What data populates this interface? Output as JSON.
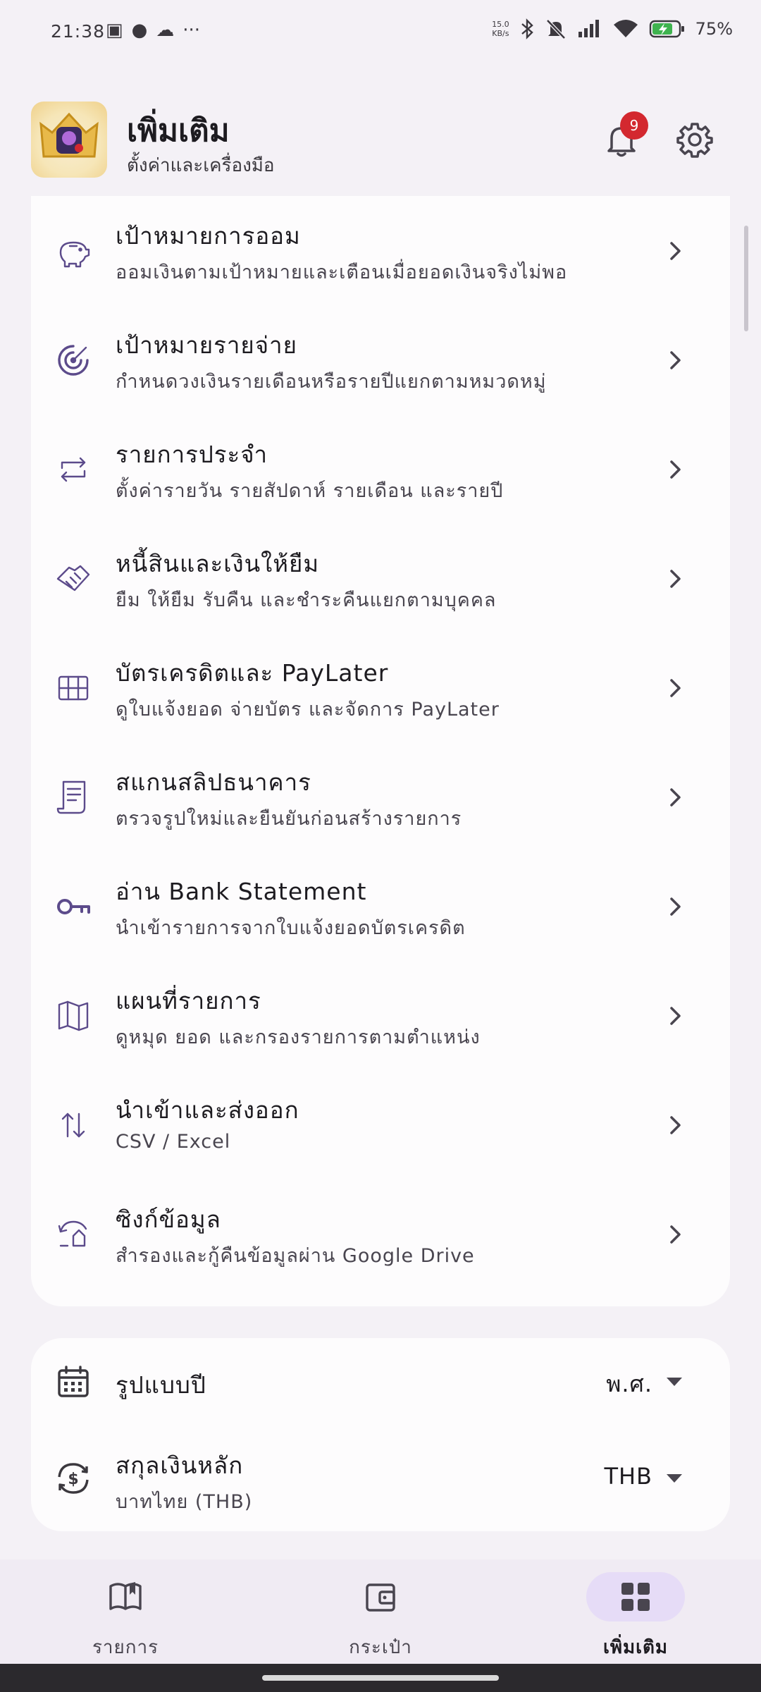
{
  "status_bar": {
    "time": "21:38",
    "speed_top": "15.0",
    "speed_bottom": "KB/s",
    "battery": "75%"
  },
  "header": {
    "title": "เพิ่มเติม",
    "subtitle": "ตั้งค่าและเครื่องมือ",
    "notification_count": "9"
  },
  "menu": {
    "items": [
      {
        "icon": "piggy-bank-icon",
        "title": "เป้าหมายการออม",
        "subtitle": "ออมเงินตามเป้าหมายและเตือนเมื่อยอดเงินจริงไม่พอ"
      },
      {
        "icon": "target-icon",
        "title": "เป้าหมายรายจ่าย",
        "subtitle": "กำหนดวงเงินรายเดือนหรือรายปีแยกตามหมวดหมู่"
      },
      {
        "icon": "repeat-icon",
        "title": "รายการประจำ",
        "subtitle": "ตั้งค่ารายวัน รายสัปดาห์ รายเดือน และรายปี"
      },
      {
        "icon": "handshake-icon",
        "title": "หนี้สินและเงินให้ยืม",
        "subtitle": "ยืม ให้ยืม รับคืน และชำระคืนแยกตามบุคคล"
      },
      {
        "icon": "grid-card-icon",
        "title": "บัตรเครดิตและ PayLater",
        "subtitle": "ดูใบแจ้งยอด จ่ายบัตร และจัดการ PayLater"
      },
      {
        "icon": "receipt-icon",
        "title": "สแกนสลิปธนาคาร",
        "subtitle": "ตรวจรูปใหม่และยืนยันก่อนสร้างรายการ"
      },
      {
        "icon": "key-icon",
        "title": "อ่าน Bank Statement",
        "subtitle": "นำเข้ารายการจากใบแจ้งยอดบัตรเครดิต"
      },
      {
        "icon": "map-icon",
        "title": "แผนที่รายการ",
        "subtitle": "ดูหมุด ยอด และกรองรายการตามตำแหน่ง"
      },
      {
        "icon": "import-export-icon",
        "title": "นำเข้าและส่งออก",
        "subtitle": "CSV / Excel"
      },
      {
        "icon": "sync-icon",
        "title": "ซิงก์ข้อมูล",
        "subtitle": "สำรองและกู้คืนข้อมูลผ่าน Google Drive"
      }
    ]
  },
  "settings": {
    "year_format": {
      "label": "รูปแบบปี",
      "value": "พ.ศ."
    },
    "currency": {
      "label": "สกุลเงินหลัก",
      "subtitle": "บาทไทย (THB)",
      "value": "THB"
    }
  },
  "bottom_nav": {
    "tabs": [
      {
        "label": "รายการ",
        "icon": "book-icon",
        "active": false
      },
      {
        "label": "กระเป๋า",
        "icon": "wallet-icon",
        "active": false
      },
      {
        "label": "เพิ่มเติม",
        "icon": "apps-grid-icon",
        "active": true
      }
    ]
  },
  "colors": {
    "accent": "#5c4b8b",
    "badge": "#d3282f",
    "active_pill": "#e6dcf7",
    "background": "#f4f1f6",
    "card": "#fdfcfd"
  }
}
